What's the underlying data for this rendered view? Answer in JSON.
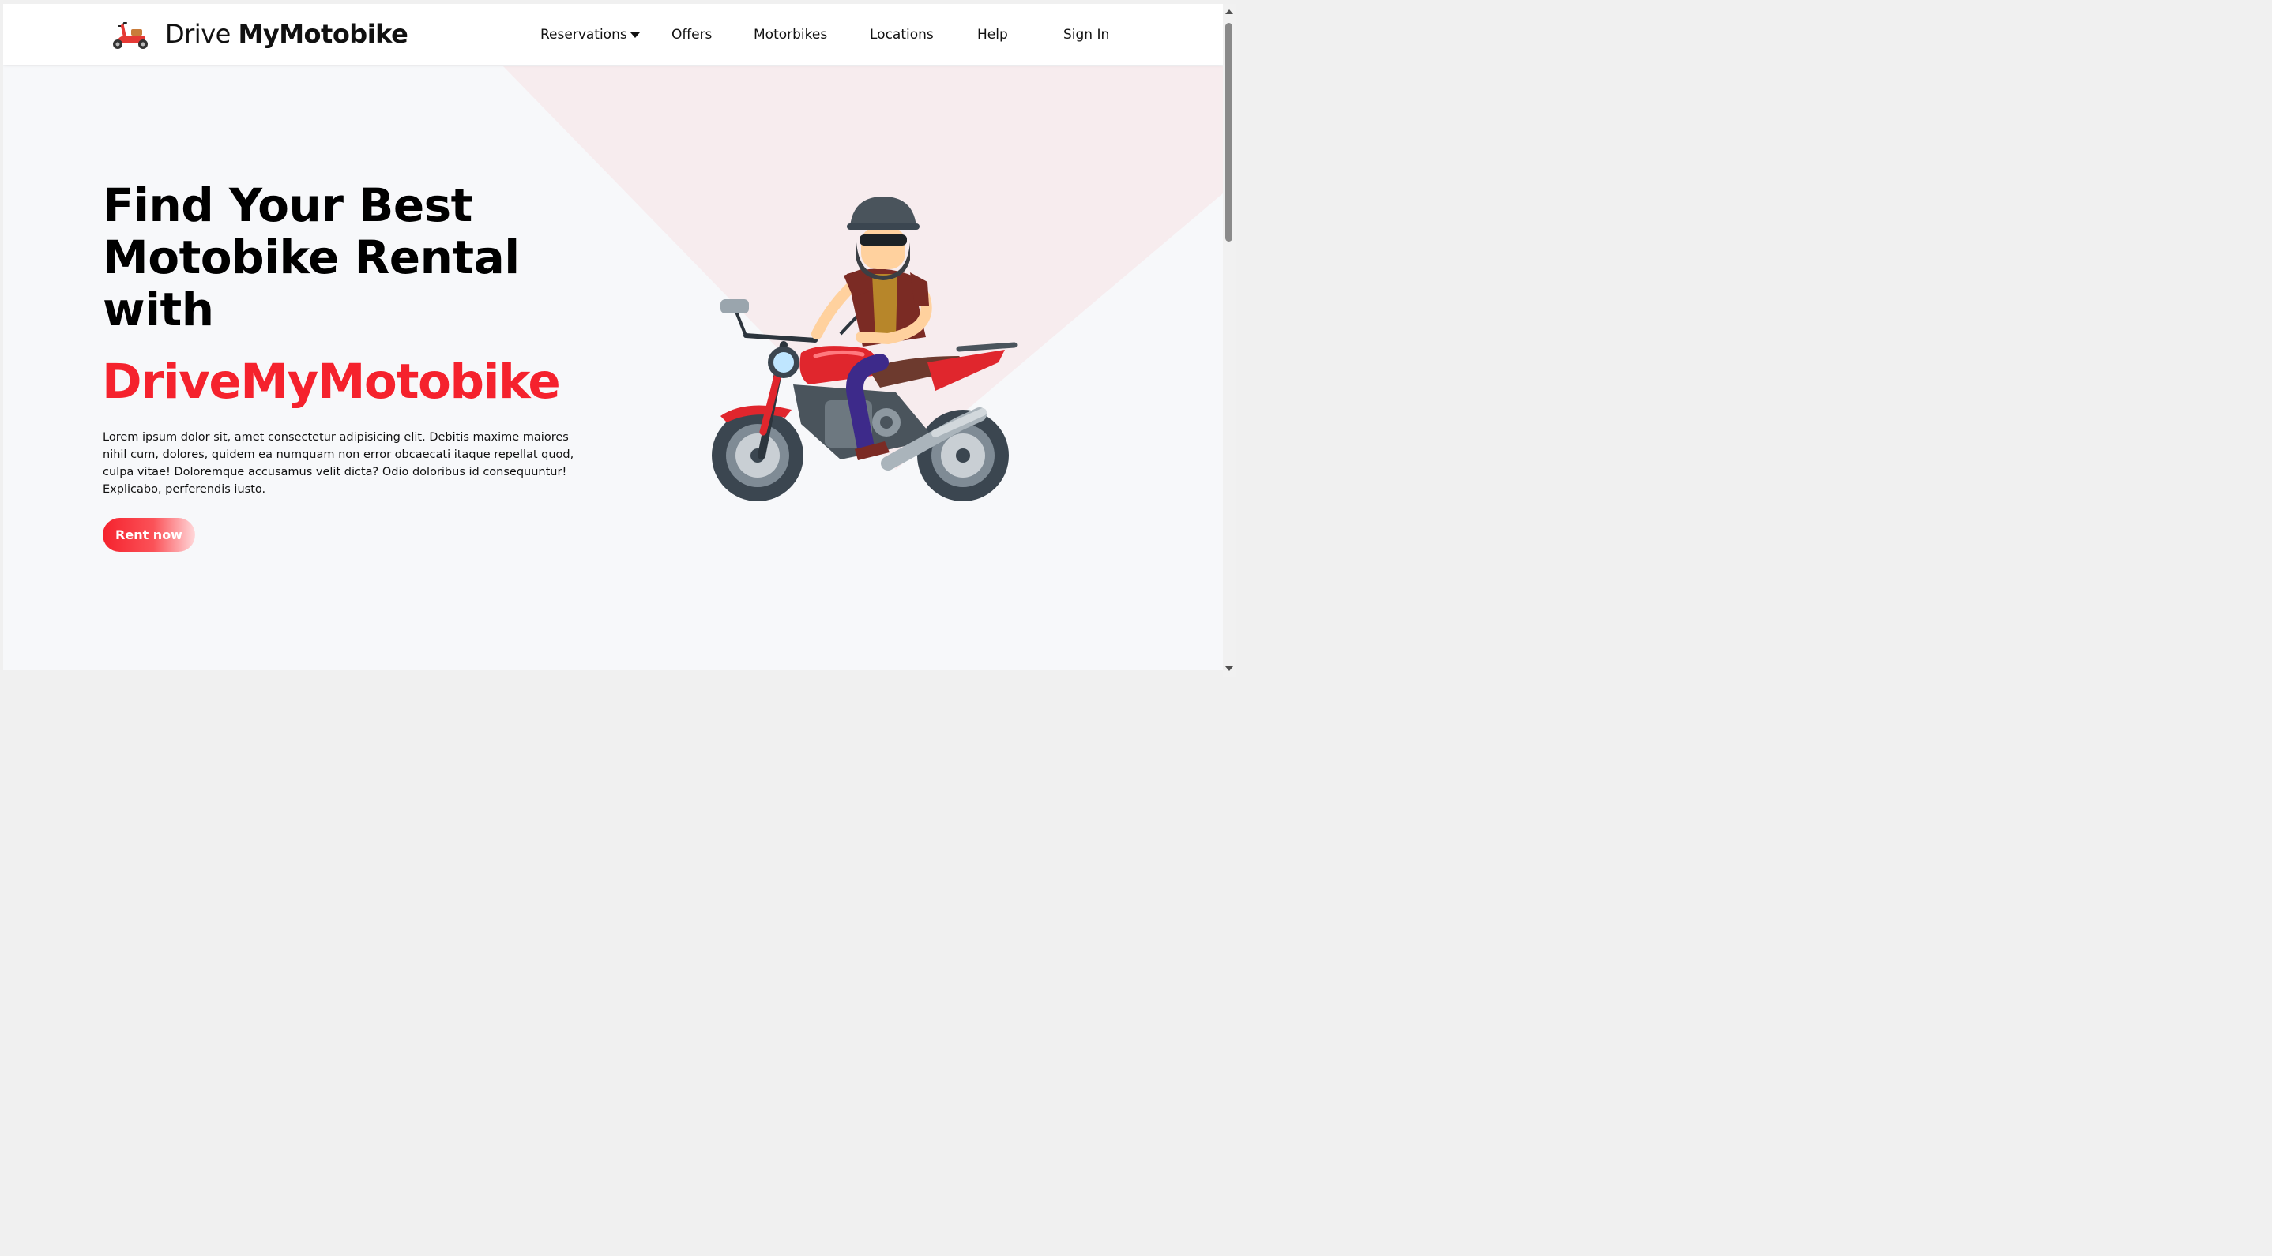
{
  "header": {
    "brand_light": "Drive ",
    "brand_bold": "MyMotobike",
    "logo_icon": "scooter-icon",
    "nav": [
      {
        "label": "Reservations",
        "has_dropdown": true
      },
      {
        "label": "Offers"
      },
      {
        "label": "Motorbikes"
      },
      {
        "label": "Locations"
      },
      {
        "label": "Help"
      },
      {
        "label": "Sign In"
      }
    ]
  },
  "hero": {
    "title": "Find Your Best Motobike Rental with",
    "brand": "DriveMyMotobike",
    "description": "Lorem ipsum dolor sit, amet consectetur adipisicing elit. Debitis maxime maiores nihil cum, dolores, quidem ea numquam non error obcaecati itaque repellat quod, culpa vitae! Doloremque accusamus velit dicta? Odio doloribus id consequuntur! Explicabo, perferendis iusto.",
    "cta_label": "Rent now",
    "illustration": "motorbike-rider-illustration"
  },
  "colors": {
    "accent": "#f5222d",
    "background": "#f7f8fa",
    "shape": "#f7ecee",
    "text": "#111111"
  }
}
